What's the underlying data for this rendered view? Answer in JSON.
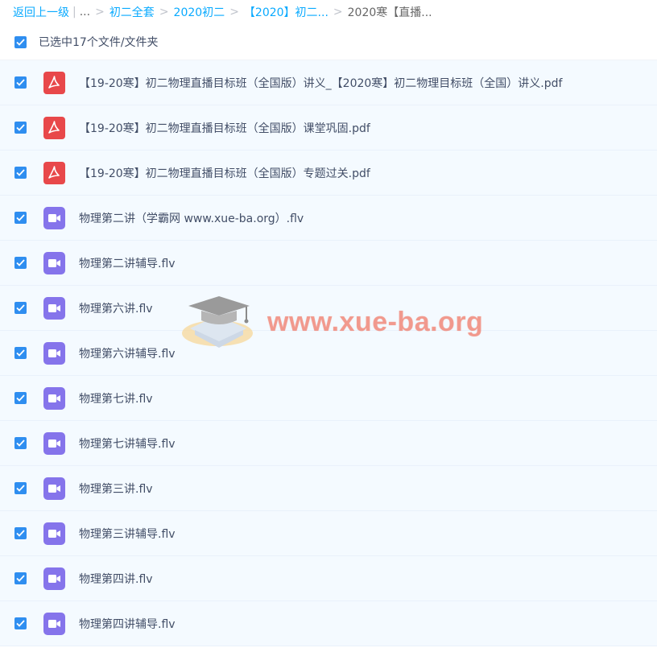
{
  "breadcrumb": {
    "back_label": "返回上一级",
    "pipe": "|",
    "ellipsis": "...",
    "separator": ">",
    "items": [
      "初二全套",
      "2020初二",
      "【2020】初二...",
      "2020寒【直播..."
    ]
  },
  "selection": {
    "label": "已选中17个文件/文件夹",
    "checked": true
  },
  "files": [
    {
      "name": "【19-20寒】初二物理直播目标班（全国版）讲义_【2020寒】初二物理目标班（全国）讲义.pdf",
      "type": "pdf",
      "checked": true
    },
    {
      "name": "【19-20寒】初二物理直播目标班（全国版）课堂巩固.pdf",
      "type": "pdf",
      "checked": true
    },
    {
      "name": "【19-20寒】初二物理直播目标班（全国版）专题过关.pdf",
      "type": "pdf",
      "checked": true
    },
    {
      "name": "物理第二讲（学霸网 www.xue-ba.org）.flv",
      "type": "video",
      "checked": true
    },
    {
      "name": "物理第二讲辅导.flv",
      "type": "video",
      "checked": true
    },
    {
      "name": "物理第六讲.flv",
      "type": "video",
      "checked": true
    },
    {
      "name": "物理第六讲辅导.flv",
      "type": "video",
      "checked": true
    },
    {
      "name": "物理第七讲.flv",
      "type": "video",
      "checked": true
    },
    {
      "name": "物理第七讲辅导.flv",
      "type": "video",
      "checked": true
    },
    {
      "name": "物理第三讲.flv",
      "type": "video",
      "checked": true
    },
    {
      "name": "物理第三讲辅导.flv",
      "type": "video",
      "checked": true
    },
    {
      "name": "物理第四讲.flv",
      "type": "video",
      "checked": true
    },
    {
      "name": "物理第四讲辅导.flv",
      "type": "video",
      "checked": true
    }
  ],
  "icons": {
    "pdf": "pdf-file-icon",
    "video": "video-file-icon",
    "checkbox": "checkmark-icon"
  },
  "colors": {
    "link": "#09aaff",
    "checkbox": "#2f8ef0",
    "pdf_icon": "#e8484a",
    "video_icon": "#8574eb",
    "row_bg": "#f4faff",
    "text": "#424e67"
  },
  "watermark": {
    "text": "www.xue-ba.org"
  }
}
